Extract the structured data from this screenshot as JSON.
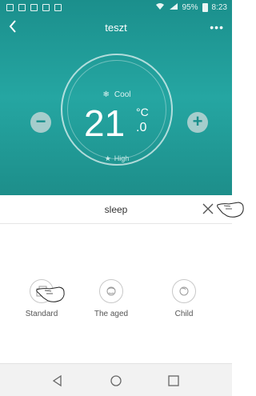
{
  "status_bar": {
    "battery": "95%",
    "time": "8:23"
  },
  "header": {
    "title": "teszt",
    "more": "•••"
  },
  "climate": {
    "mode": "Cool",
    "temperature": "21",
    "unit": "°C",
    "decimal": ".0",
    "fan_speed": "High",
    "accent_color": "#1b8f8c"
  },
  "sleep_sheet": {
    "title": "sleep",
    "options": [
      {
        "label": "Standard",
        "icon": "standard-icon"
      },
      {
        "label": "The aged",
        "icon": "aged-face-icon"
      },
      {
        "label": "Child",
        "icon": "child-face-icon"
      }
    ]
  },
  "system_nav": {
    "icons": [
      "back-triangle-icon",
      "home-circle-icon",
      "recents-square-icon"
    ]
  }
}
